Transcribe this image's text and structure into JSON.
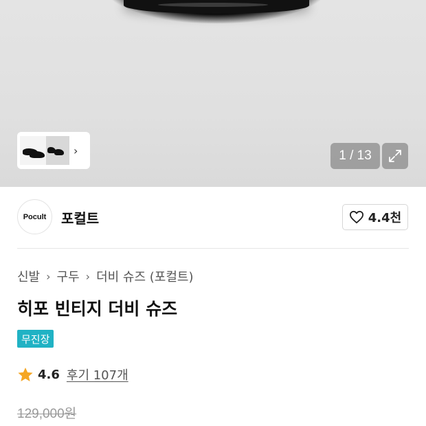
{
  "gallery": {
    "counter": "1 / 13",
    "thumbnail_arrow": "›"
  },
  "brand": {
    "logo_text": "Pocult",
    "name": "포컬트",
    "like_count": "4.4천"
  },
  "breadcrumb": {
    "items": [
      "신발",
      "구두",
      "더비 슈즈 (포컬트)"
    ]
  },
  "product": {
    "title": "히포 빈티지 더비 슈즈",
    "badge": "무진장",
    "rating": "4.6",
    "review_link": "후기 107개",
    "original_price": "129,000원"
  },
  "colors": {
    "badge_bg": "#20b2c4",
    "star": "#f5a623"
  },
  "icons": [
    "chevron-right-icon",
    "expand-icon",
    "heart-outline-icon",
    "star-icon"
  ]
}
